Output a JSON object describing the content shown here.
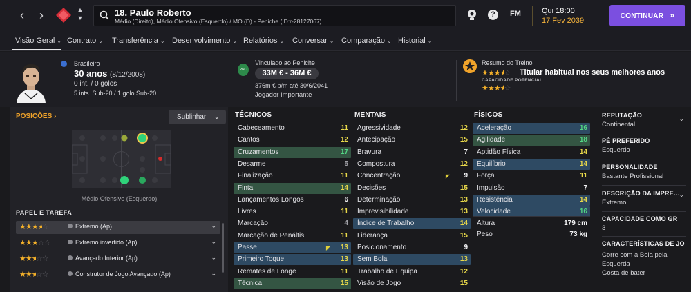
{
  "topbar": {
    "back_icon": "chevron-left",
    "forward_icon": "chevron-right",
    "player_title": "18. Paulo Roberto",
    "player_subtitle": "Médio (Direito), Médio Ofensivo (Esquerdo) / MO (D) - Peniche (ID:r-28127067)",
    "fm_label": "FM",
    "help_label": "?",
    "date_time": "Qui 18:00",
    "date_day": "17 Fev 2039",
    "continue_label": "CONTINUAR",
    "continue_chevron": "»",
    "accent_color": "#7b4fe0",
    "date_color": "#f2b13b"
  },
  "tabs": [
    {
      "label": "Visão Geral",
      "chev": "⌄"
    },
    {
      "label": "Contrato",
      "chev": "⌄"
    },
    {
      "label": "Transferência",
      "chev": "⌄"
    },
    {
      "label": "Desenvolvimento",
      "chev": "⌄"
    },
    {
      "label": "Relatórios",
      "chev": "⌄"
    },
    {
      "label": "Conversar",
      "chev": "⌄"
    },
    {
      "label": "Comparação",
      "chev": "⌄"
    },
    {
      "label": "Historial",
      "chev": "⌄"
    }
  ],
  "header": {
    "nationality": "Brasileiro",
    "age": "30 anos",
    "dob": "(8/12/2008)",
    "intl": "0 int. / 0 golos",
    "youth": "5 ints. Sub-20 / 1 golo Sub-20",
    "club_label": "Vinculado ao Peniche",
    "value": "33M € - 36M €",
    "wage": "376m € p/m até 30/6/2041",
    "status": "Jogador Importante",
    "training_title": "Resumo do Treino",
    "training_summary": "Titular habitual nos seus melhores anos",
    "current_ability_stars": 3.5,
    "potential_label": "CAPACIDADE POTENCIAL",
    "potential_ability_stars": 3.5
  },
  "positions": {
    "title": "POSIÇÕES",
    "title_chevron": "›",
    "highlight_label": "Sublinhar",
    "highlight_chevron": "⌄",
    "position_caption": "Médio Ofensivo (Esquerdo)",
    "roles_title": "PAPEL E TAREFA",
    "roles": [
      {
        "name": "Extremo (Ap)",
        "stars": 3.5,
        "selected": true
      },
      {
        "name": "Extremo invertido (Ap)",
        "stars": 3,
        "selected": false
      },
      {
        "name": "Avançado Interior (Ap)",
        "stars": 2.5,
        "selected": false
      },
      {
        "name": "Construtor de Jogo Avançado (Ap)",
        "stars": 2.5,
        "selected": false
      }
    ]
  },
  "tecnicos": {
    "title": "TÉCNICOS",
    "rows": [
      {
        "name": "Cabeceamento",
        "value": 11,
        "hl": ""
      },
      {
        "name": "Cantos",
        "value": 12,
        "hl": ""
      },
      {
        "name": "Cruzamentos",
        "value": 17,
        "hl": "green"
      },
      {
        "name": "Desarme",
        "value": 5,
        "hl": ""
      },
      {
        "name": "Finalização",
        "value": 11,
        "hl": ""
      },
      {
        "name": "Finta",
        "value": 14,
        "hl": "green"
      },
      {
        "name": "Lançamentos Longos",
        "value": 6,
        "hl": ""
      },
      {
        "name": "Livres",
        "value": 11,
        "hl": ""
      },
      {
        "name": "Marcação",
        "value": 4,
        "hl": ""
      },
      {
        "name": "Marcação de Penáltis",
        "value": 11,
        "hl": ""
      },
      {
        "name": "Passe",
        "value": 13,
        "hl": "blue",
        "flag": true
      },
      {
        "name": "Primeiro Toque",
        "value": 13,
        "hl": "blue"
      },
      {
        "name": "Remates de Longe",
        "value": 11,
        "hl": ""
      },
      {
        "name": "Técnica",
        "value": 15,
        "hl": "green"
      }
    ]
  },
  "mentais": {
    "title": "MENTAIS",
    "rows": [
      {
        "name": "Agressividade",
        "value": 12,
        "hl": ""
      },
      {
        "name": "Antecipação",
        "value": 15,
        "hl": ""
      },
      {
        "name": "Bravura",
        "value": 7,
        "hl": ""
      },
      {
        "name": "Compostura",
        "value": 12,
        "hl": ""
      },
      {
        "name": "Concentração",
        "value": 9,
        "hl": "",
        "flag": true
      },
      {
        "name": "Decisões",
        "value": 15,
        "hl": ""
      },
      {
        "name": "Determinação",
        "value": 13,
        "hl": ""
      },
      {
        "name": "Imprevisibilidade",
        "value": 13,
        "hl": ""
      },
      {
        "name": "Índice de Trabalho",
        "value": 14,
        "hl": "blue"
      },
      {
        "name": "Liderança",
        "value": 15,
        "hl": ""
      },
      {
        "name": "Posicionamento",
        "value": 9,
        "hl": ""
      },
      {
        "name": "Sem Bola",
        "value": 13,
        "hl": "blue"
      },
      {
        "name": "Trabalho de Equipa",
        "value": 12,
        "hl": ""
      },
      {
        "name": "Visão de Jogo",
        "value": 15,
        "hl": ""
      }
    ]
  },
  "fisicos": {
    "title": "FÍSICOS",
    "rows": [
      {
        "name": "Aceleração",
        "value": 16,
        "hl": "blue"
      },
      {
        "name": "Agilidade",
        "value": 18,
        "hl": "green"
      },
      {
        "name": "Aptidão Física",
        "value": 14,
        "hl": ""
      },
      {
        "name": "Equilíbrio",
        "value": 14,
        "hl": "blue"
      },
      {
        "name": "Força",
        "value": 11,
        "hl": ""
      },
      {
        "name": "Impulsão",
        "value": 7,
        "hl": ""
      },
      {
        "name": "Resistência",
        "value": 14,
        "hl": "blue"
      },
      {
        "name": "Velocidade",
        "value": 16,
        "hl": "blue"
      }
    ],
    "height_label": "Altura",
    "height_value": "179 cm",
    "weight_label": "Peso",
    "weight_value": "73 kg"
  },
  "side": {
    "reputation_label": "REPUTAÇÃO",
    "reputation_value": "Continental",
    "foot_label": "PÉ PREFERIDO",
    "foot_value": "Esquerdo",
    "personality_label": "PERSONALIDADE",
    "personality_value": "Bastante Profissional",
    "media_label": "DESCRIÇÃO DA IMPRE…",
    "media_value": "Extremo",
    "gk_label": "CAPACIDADE COMO GR",
    "gk_value": "3",
    "traits_label": "CARACTERÍSTICAS DE JO",
    "traits": [
      "Corre com a Bola pela",
      "Esquerda",
      "Gosta de bater"
    ]
  }
}
